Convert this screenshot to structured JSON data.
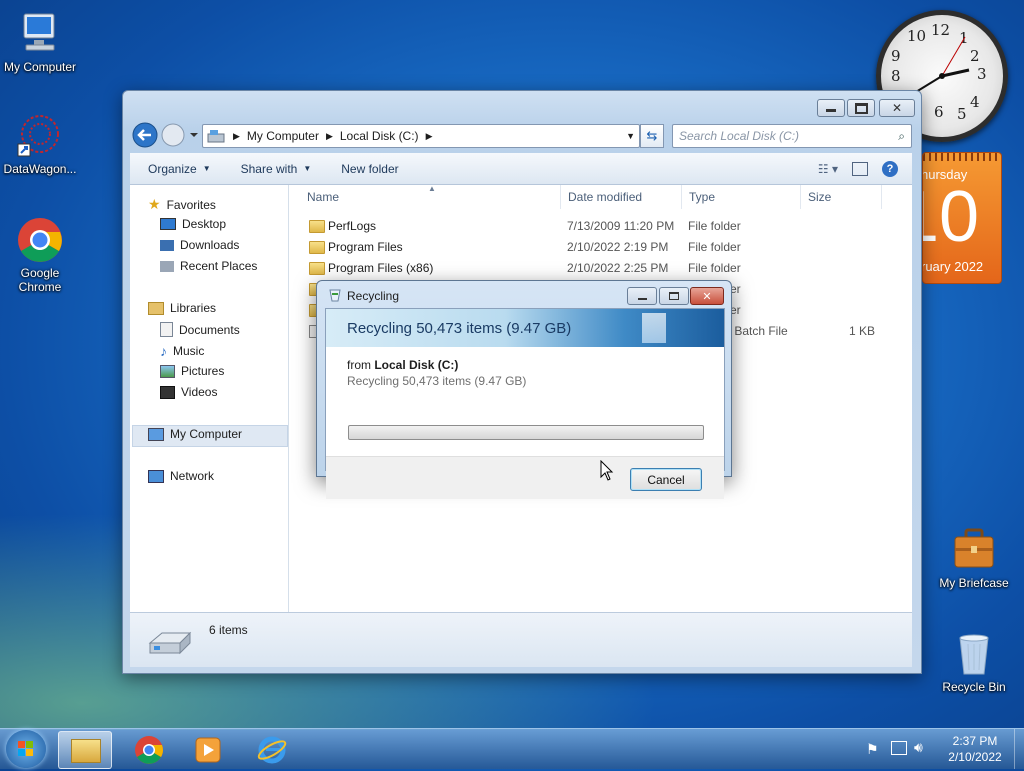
{
  "desktop": {
    "icons": [
      {
        "label": "My Computer"
      },
      {
        "label": "DataWagon..."
      },
      {
        "label": "Google Chrome"
      },
      {
        "label": "My Briefcase"
      },
      {
        "label": "Recycle Bin"
      }
    ]
  },
  "gadgets": {
    "clock_numbers": [
      "12",
      "1",
      "2",
      "3",
      "4",
      "5",
      "6",
      "7",
      "8",
      "9",
      "10",
      "11"
    ],
    "calendar": {
      "weekday": "hursday",
      "day": "10",
      "month": "ruary 2022"
    }
  },
  "explorer": {
    "breadcrumb": [
      "My Computer",
      "Local Disk (C:)"
    ],
    "search_placeholder": "Search Local Disk (C:)",
    "toolbar": {
      "organize": "Organize",
      "share_with": "Share with",
      "new_folder": "New folder"
    },
    "nav": {
      "favorites": "Favorites",
      "favorites_items": [
        "Desktop",
        "Downloads",
        "Recent Places"
      ],
      "libraries": "Libraries",
      "libraries_items": [
        "Documents",
        "Music",
        "Pictures",
        "Videos"
      ],
      "computer": "My Computer",
      "network": "Network"
    },
    "columns": {
      "name": "Name",
      "date": "Date modified",
      "type": "Type",
      "size": "Size"
    },
    "files": [
      {
        "name": "PerfLogs",
        "date": "7/13/2009 11:20 PM",
        "type": "File folder",
        "size": ""
      },
      {
        "name": "Program Files",
        "date": "2/10/2022 2:19 PM",
        "type": "File folder",
        "size": ""
      },
      {
        "name": "Program Files (x86)",
        "date": "2/10/2022 2:25 PM",
        "type": "File folder",
        "size": ""
      },
      {
        "name": "",
        "date": "",
        "type": "er",
        "size": ""
      },
      {
        "name": "",
        "date": "",
        "type": "er",
        "size": ""
      },
      {
        "name": "",
        "date": "",
        "type": "s Batch File",
        "size": "1 KB"
      }
    ],
    "status": {
      "count": "6 items"
    }
  },
  "dialog": {
    "title": "Recycling",
    "heading": "Recycling 50,473 items (9.47 GB)",
    "from_label": "from",
    "from_location": "Local Disk (C:)",
    "detail": "Recycling 50,473 items (9.47 GB)",
    "progress": 0.0,
    "cancel": "Cancel"
  },
  "taskbar": {
    "time": "2:37 PM",
    "date": "2/10/2022"
  }
}
